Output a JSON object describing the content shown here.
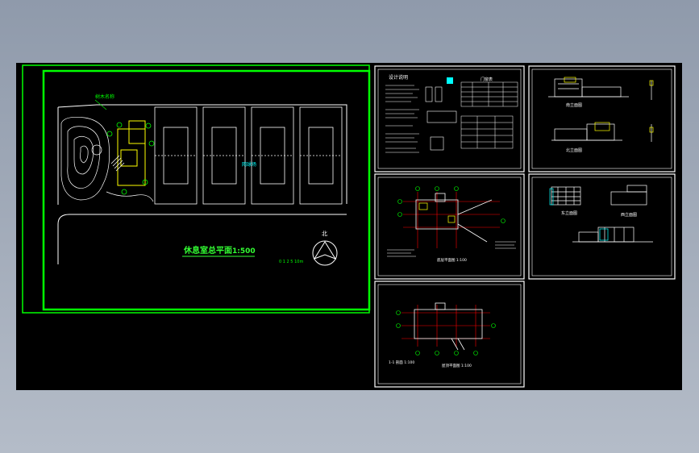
{
  "drawing": {
    "site_plan": {
      "title": "休息室总平面",
      "scale": "1:500",
      "scale_bar_label": "0 1 2     5         10m",
      "north_label": "北",
      "tree_label": "树木名称",
      "court_label": "网球场"
    },
    "notes_sheet": {
      "title": "设计说明",
      "table_title": "门窗表"
    },
    "floor_plan_sheet": {
      "caption": "底层平面图 1:100"
    },
    "roof_plan_sheet": {
      "caption": "屋顶平面图 1:100",
      "left_note": "1-1 剖面 1:100"
    },
    "elevations_sheet": {
      "label_a": "南立面图",
      "label_b": "北立面图"
    },
    "elevations_sheet_2": {
      "label_a": "东立面图",
      "label_b": "西立面图"
    }
  },
  "colors": {
    "background": "#000000",
    "frame_green": "#00ff00",
    "sheet_white": "#ffffff",
    "title_green": "#33ff33",
    "accent_cyan": "#00ffff",
    "axis_red": "#ff0000"
  }
}
